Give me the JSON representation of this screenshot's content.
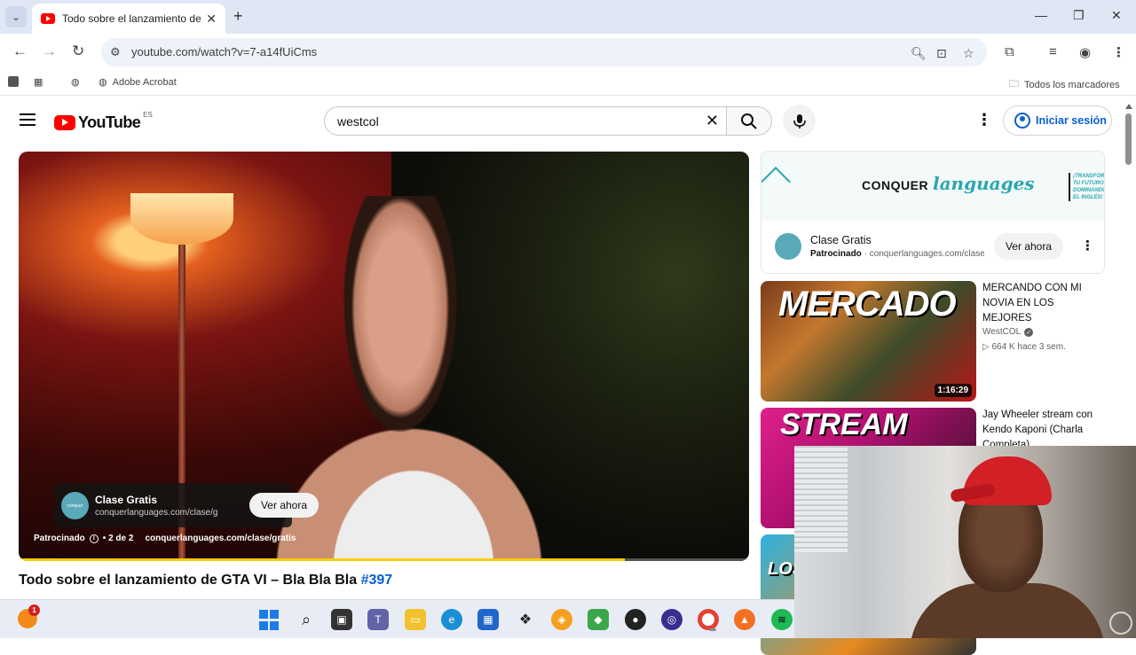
{
  "browser": {
    "tab_title": "Todo sobre el lanzamiento de GTA VI",
    "url": "youtube.com/watch?v=7-a14fUiCms",
    "bookmarks": {
      "item_1": "Adobe Acrobat",
      "all": "Todos los marcadores"
    }
  },
  "youtube": {
    "logo": "YouTube",
    "country_code": "ES",
    "search_query": "westcol",
    "signin_label": "Iniciar sesión"
  },
  "player": {
    "ad_title": "Clase Gratis",
    "ad_site": "conquerlanguages.com/clase/gratis",
    "ad_cta": "Ver ahora",
    "ad_label": "Patrocinado",
    "ad_count": "• 2 de 2",
    "ad_url": "conquerlanguages.com/clase/gratis",
    "progress_fraction": 0.83
  },
  "video": {
    "title": "Todo sobre el lanzamiento de GTA VI – Bla Bla Bla",
    "hashtag": "#397"
  },
  "sidebar_ad": {
    "brand_a": "CONQUER",
    "brand_b": "languages",
    "promo": "¡TRANSFORMA TU FUTURO DOMINANDO EL INGLÉS!",
    "title": "Clase Gratis",
    "sponsored": "Patrocinado",
    "site": "conquerlanguages.com/clase/gratis",
    "cta": "Ver ahora"
  },
  "recommendations": [
    {
      "thumb_text": "MERCADO",
      "title": "MERCANDO CON MI NOVIA EN LOS MEJORES SUPERMERCADOS DE ...",
      "channel": "WestCOL",
      "stats": "▷ 664 K  hace 3 sem.",
      "duration": "1:16:29"
    },
    {
      "thumb_text": "STREAM",
      "title": "Jay Wheeler stream con Kendo Kaponi (Charla Completa)"
    },
    {
      "thumb_text": "LOS NA"
    }
  ],
  "taskbar": {
    "weather_badge": "1"
  },
  "colors": {
    "yt_red": "#ff0000",
    "link_blue": "#065fd4",
    "progress": "#ffcc00"
  }
}
